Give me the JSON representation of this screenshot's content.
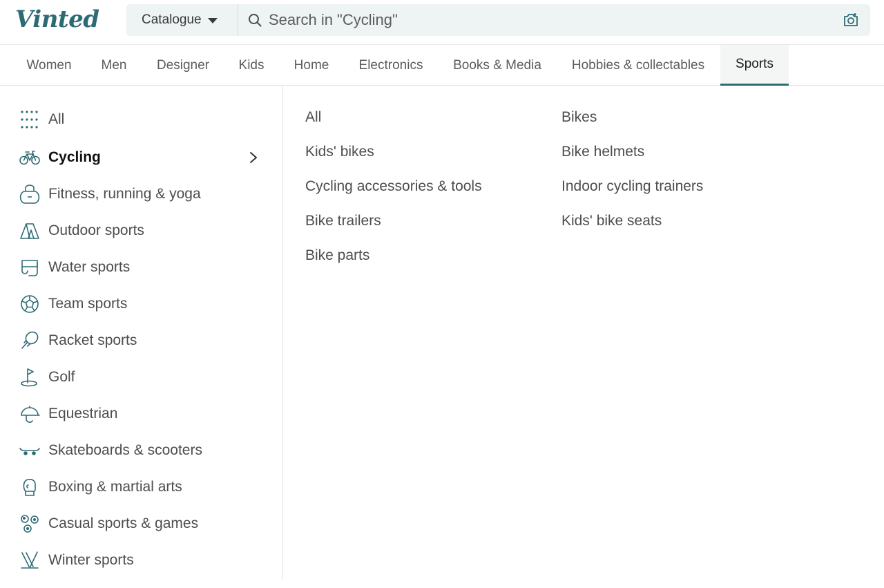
{
  "header": {
    "logo": "Vinted",
    "catalogue_label": "Catalogue",
    "search_placeholder": "Search in \"Cycling\""
  },
  "nav": {
    "tabs": [
      {
        "label": "Women"
      },
      {
        "label": "Men"
      },
      {
        "label": "Designer"
      },
      {
        "label": "Kids"
      },
      {
        "label": "Home"
      },
      {
        "label": "Electronics"
      },
      {
        "label": "Books & Media"
      },
      {
        "label": "Hobbies & collectables"
      },
      {
        "label": "Sports",
        "active": true
      }
    ]
  },
  "sidebar": {
    "items": [
      {
        "label": "All",
        "icon": "grid-icon"
      },
      {
        "label": "Cycling",
        "icon": "bicycle-icon",
        "active": true
      },
      {
        "label": "Fitness, running & yoga",
        "icon": "kettlebell-icon"
      },
      {
        "label": "Outdoor sports",
        "icon": "tent-icon"
      },
      {
        "label": "Water sports",
        "icon": "snorkel-mask-icon"
      },
      {
        "label": "Team sports",
        "icon": "football-icon"
      },
      {
        "label": "Racket sports",
        "icon": "racket-icon"
      },
      {
        "label": "Golf",
        "icon": "golf-flag-icon"
      },
      {
        "label": "Equestrian",
        "icon": "riding-helmet-icon"
      },
      {
        "label": "Skateboards & scooters",
        "icon": "skateboard-icon"
      },
      {
        "label": "Boxing & martial arts",
        "icon": "boxing-glove-icon"
      },
      {
        "label": "Casual sports & games",
        "icon": "balls-icon"
      },
      {
        "label": "Winter sports",
        "icon": "skis-icon"
      }
    ]
  },
  "subcategories": {
    "column1": [
      "All",
      "Kids' bikes",
      "Cycling accessories & tools",
      "Bike trailers",
      "Bike parts"
    ],
    "column2": [
      "Bikes",
      "Bike helmets",
      "Indoor cycling trainers",
      "Kids' bike seats"
    ]
  },
  "colors": {
    "accent": "#2d6b74",
    "text": "#4d4d4d",
    "search_bg": "#eef3f3"
  }
}
